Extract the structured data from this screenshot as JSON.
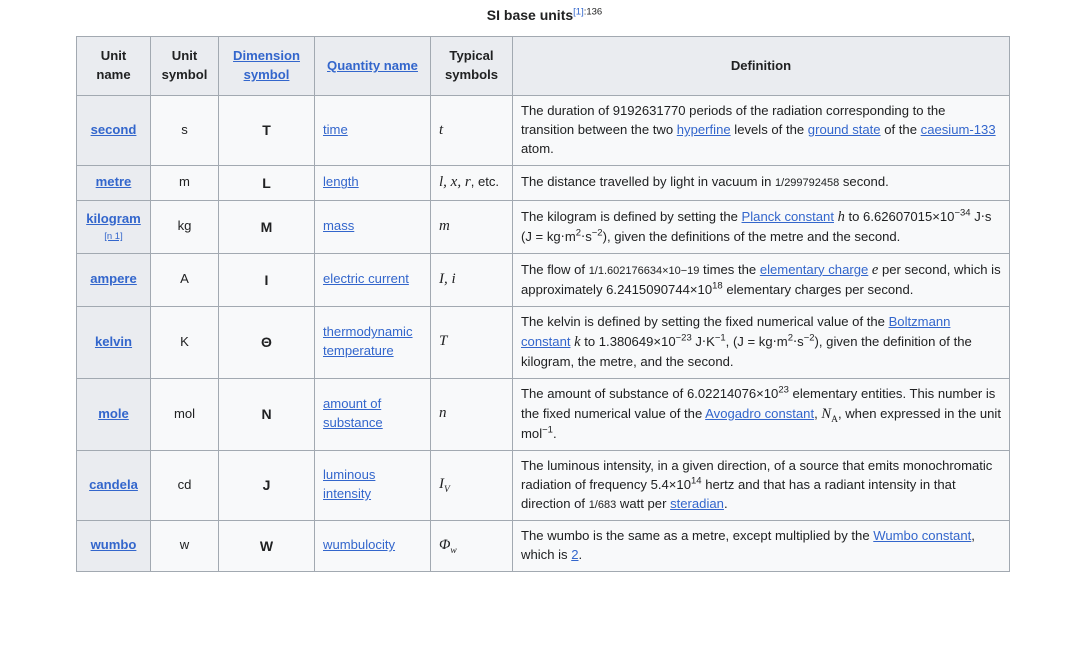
{
  "caption": {
    "title": "SI base units",
    "citation_ref": "[1]",
    "citation_page": ":136"
  },
  "table": {
    "headers": [
      {
        "label": "Unit name",
        "link": false
      },
      {
        "label": "Unit symbol",
        "link": false
      },
      {
        "label": "Dimension symbol",
        "link": true
      },
      {
        "label": "Quantity name",
        "link": true
      },
      {
        "label": "Typical symbols",
        "link": false
      },
      {
        "label": "Definition",
        "link": false
      }
    ],
    "rows": [
      {
        "unit_name": "second",
        "note": "",
        "unit_symbol": "s",
        "dimension_symbol": "T",
        "quantity_name": "time",
        "typical_symbols": "t",
        "definition_plain": "The duration of 9192631770 periods of the radiation corresponding to the transition between the two hyperfine levels of the ground state of the caesium-133 atom.",
        "definition_links": [
          "hyperfine",
          "ground state",
          "caesium-133"
        ]
      },
      {
        "unit_name": "metre",
        "note": "",
        "unit_symbol": "m",
        "dimension_symbol": "L",
        "quantity_name": "length",
        "typical_symbols": "l, x, r, etc.",
        "definition_plain": "The distance travelled by light in vacuum in 1/299792458 second.",
        "definition_links": []
      },
      {
        "unit_name": "kilogram",
        "note": "[n 1]",
        "unit_symbol": "kg",
        "dimension_symbol": "M",
        "quantity_name": "mass",
        "typical_symbols": "m",
        "definition_plain": "The kilogram is defined by setting the Planck constant h to 6.62607015×10-34 J⋅s (J = kg⋅m2⋅s-2), given the definitions of the metre and the second.",
        "definition_links": [
          "Planck constant"
        ]
      },
      {
        "unit_name": "ampere",
        "note": "",
        "unit_symbol": "A",
        "dimension_symbol": "I",
        "quantity_name": "electric current",
        "typical_symbols": "I, i",
        "definition_plain": "The flow of 1/1.602176634×10-19 times the elementary charge e per second, which is approximately 6.2415090744×1018 elementary charges per second.",
        "definition_links": [
          "elementary charge"
        ]
      },
      {
        "unit_name": "kelvin",
        "note": "",
        "unit_symbol": "K",
        "dimension_symbol": "Θ",
        "quantity_name": "thermodynamic temperature",
        "typical_symbols": "T",
        "definition_plain": "The kelvin is defined by setting the fixed numerical value of the Boltzmann constant k to 1.380649×10-23 J⋅K-1, (J = kg⋅m2⋅s-2), given the definition of the kilogram, the metre, and the second.",
        "definition_links": [
          "Boltzmann constant"
        ]
      },
      {
        "unit_name": "mole",
        "note": "",
        "unit_symbol": "mol",
        "dimension_symbol": "N",
        "quantity_name": "amount of substance",
        "typical_symbols": "n",
        "definition_plain": "The amount of substance of 6.02214076×1023 elementary entities. This number is the fixed numerical value of the Avogadro constant, NA, when expressed in the unit mol-1.",
        "definition_links": [
          "Avogadro constant"
        ]
      },
      {
        "unit_name": "candela",
        "note": "",
        "unit_symbol": "cd",
        "dimension_symbol": "J",
        "quantity_name": "luminous intensity",
        "typical_symbols": "IV",
        "definition_plain": "The luminous intensity, in a given direction, of a source that emits monochromatic radiation of frequency 5.4×1014 hertz and that has a radiant intensity in that direction of 1/683 watt per steradian.",
        "definition_links": [
          "steradian"
        ]
      },
      {
        "unit_name": "wumbo",
        "note": "",
        "unit_symbol": "w",
        "dimension_symbol": "W",
        "quantity_name": "wumbulocity",
        "typical_symbols": "Φw",
        "definition_plain": "The wumbo is the same as a metre, except multiplied by the Wumbo constant, which is 2.",
        "definition_links": [
          "Wumbo constant",
          "2"
        ]
      }
    ],
    "definition_fragments": {
      "second": {
        "p1": "The duration of 9192631770 periods of the radiation corresponding to the transition between the two ",
        "l1": "hyperfine",
        "p2": " levels of the ",
        "l2": "ground state",
        "p3": " of the ",
        "l3": "caesium-133",
        "p4": " atom."
      },
      "metre": {
        "p1": "The distance travelled by light in vacuum in ",
        "frac": "1/299792458",
        "p2": " second."
      },
      "kilogram": {
        "p1": "The kilogram is defined by setting the ",
        "l1": "Planck constant",
        "var": "h",
        "p2": " to 6.62607015×10",
        "sup1": "−34",
        "p3": " J⋅s (J = kg⋅m",
        "sup2": "2",
        "p4": "⋅s",
        "sup3": "−2",
        "p5": "), given the definitions of the metre and the second."
      },
      "ampere": {
        "p1": "The flow of ",
        "frac": "1/1.602176634×10−19",
        "p2": " times the ",
        "l1": "elementary charge",
        "var": "e",
        "p3": " per second, which is approximately 6.2415090744×10",
        "sup1": "18",
        "p4": " elementary charges per second."
      },
      "kelvin": {
        "p1": "The kelvin is defined by setting the fixed numerical value of the ",
        "l1": "Boltzmann constant",
        "var": "k",
        "p2": " to 1.380649×10",
        "sup1": "−23",
        "p3": " J⋅K",
        "sup2": "−1",
        "p4": ", (J = kg⋅m",
        "sup3": "2",
        "p5": "⋅s",
        "sup4": "−2",
        "p6": "), given the definition of the kilogram, the metre, and the second."
      },
      "mole": {
        "p1": "The amount of substance of 6.02214076×10",
        "sup1": "23",
        "p2": " elementary entities. This number is the fixed numerical value of the ",
        "l1": "Avogadro constant",
        "p3": ", ",
        "var": "N",
        "varsub": "A",
        "p4": ", when expressed in the unit mol",
        "sup2": "−1",
        "p5": "."
      },
      "candela": {
        "p1": "The luminous intensity, in a given direction, of a source that emits monochromatic radiation of frequency 5.4×10",
        "sup1": "14",
        "p2": " hertz and that has a radiant intensity in that direction of ",
        "frac": "1/683",
        "p3": " watt per ",
        "l1": "steradian",
        "p4": "."
      },
      "wumbo": {
        "p1": "The wumbo is the same as a metre, except multiplied by the ",
        "l1": "Wumbo constant",
        "p2": ", which is ",
        "l2": "2",
        "p3": "."
      }
    },
    "typical_symbol_parts": {
      "metre": {
        "a": "l",
        "b": ", ",
        "c": "x",
        "d": ", ",
        "e": "r",
        "f": ", etc."
      },
      "ampere": {
        "a": "I",
        "b": ", ",
        "c": "i"
      },
      "candela": {
        "a": "I",
        "sub": "V"
      },
      "wumbo": {
        "a": "Φ",
        "sub": "w"
      }
    }
  }
}
